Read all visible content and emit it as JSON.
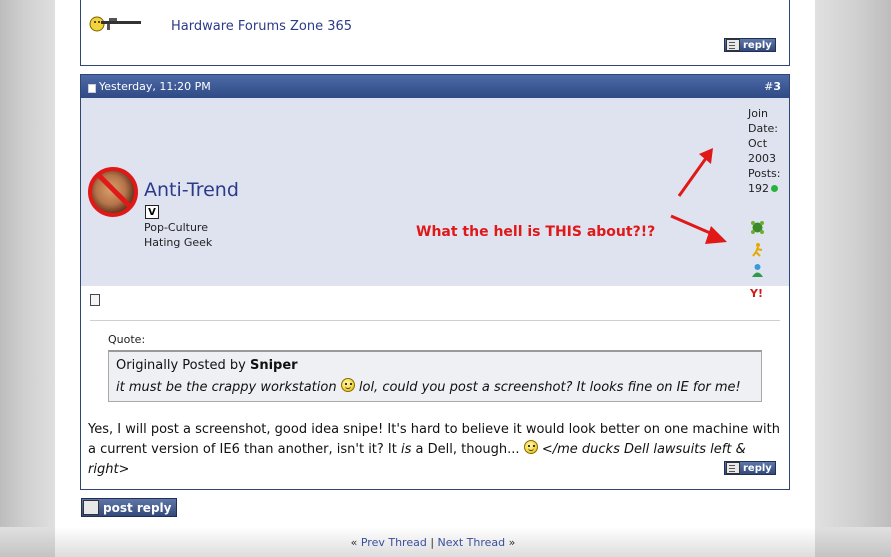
{
  "previous_post": {
    "signature_link": "Hardware Forums Zone 365",
    "reply_label": "reply"
  },
  "post": {
    "date": "Yesterday, 11:20 PM",
    "number_prefix": "#",
    "number": "3",
    "user": {
      "name": "Anti-Trend",
      "badge": "V",
      "title": "Pop-Culture Hating Geek",
      "join_label": "Join Date:",
      "join_date": "Oct 2003",
      "posts_label": "Posts:",
      "posts": "192"
    },
    "annotation": "What the hell is THIS about?!?",
    "quote": {
      "label": "Quote:",
      "originally_posted_by": "Originally Posted by",
      "author": "Sniper",
      "text_before": "it must be the crappy workstation",
      "text_after": "lol, could you post a screenshot? It looks fine on IE for me!"
    },
    "message": {
      "part1": "Yes, I will post a screenshot, good idea snipe! It's hard to believe it would look better on one machine with a current version of IE6 than another, isn't it? It",
      "italic": "is",
      "part2": "a Dell, though...",
      "part3": "</me ducks Dell lawsuits left & right>"
    },
    "reply_label": "reply"
  },
  "post_reply_label": "post reply",
  "thread_nav": {
    "prev": "Prev Thread",
    "separator": "|",
    "next": "Next Thread"
  },
  "icons": [
    "reputation-icon",
    "aim-icon",
    "msn-icon",
    "yahoo-icon"
  ],
  "colors": {
    "header_bg": "#3d5a96",
    "userinfo_bg": "#dfe3f0",
    "link": "#2c3a8a",
    "annotation": "#e01818"
  }
}
